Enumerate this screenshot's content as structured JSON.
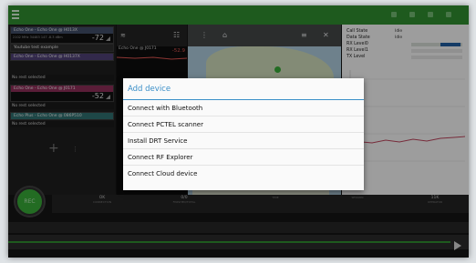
{
  "colors": {
    "brand_green": "#2f8a2f",
    "dialog_accent": "#3a8fc8",
    "rec_green": "#37a637",
    "signal_red": "#d9534f"
  },
  "devices": [
    {
      "title": "Echo One - Echo One @ H013X",
      "small": "2102 MHz   34483   147   -8.3 dBm",
      "value": "-72",
      "unit": "dBm"
    },
    {
      "title": "Youtube test example",
      "small": "",
      "value": "",
      "unit": ""
    },
    {
      "title": "Echo One - Echo One @ H0137X",
      "small": "",
      "value": "",
      "unit": ""
    }
  ],
  "no_active": "No rest selected",
  "device4": {
    "title": "Echo One - Echo One @ J0171",
    "value": "-52",
    "unit": "dBm"
  },
  "device5": {
    "title": "Echo Plus - Echo One @ 086P510"
  },
  "chart": {
    "label": "Echo One @ J0171",
    "value": "-52.9"
  },
  "state": {
    "labels": [
      "Call State",
      "Data State",
      "RX Level0",
      "RX Level1",
      "TX Level"
    ],
    "values": [
      "Idle",
      "Idle",
      "",
      "",
      ""
    ]
  },
  "rec_label": "REC",
  "stats": [
    {
      "value": "OK",
      "label": "CONNECTION"
    },
    {
      "value": "0/0",
      "label": "FINISHED/TOTAL"
    },
    {
      "value": "",
      "label": "TIME"
    },
    {
      "value": "",
      "label": "SESSION"
    },
    {
      "value": "11K",
      "label": "OPERATOR"
    }
  ],
  "dialog": {
    "title": "Add device",
    "items": [
      "Connect with Bluetooth",
      "Connect PCTEL scanner",
      "Install DRT Service",
      "Connect RF Explorer",
      "Connect Cloud device"
    ]
  }
}
